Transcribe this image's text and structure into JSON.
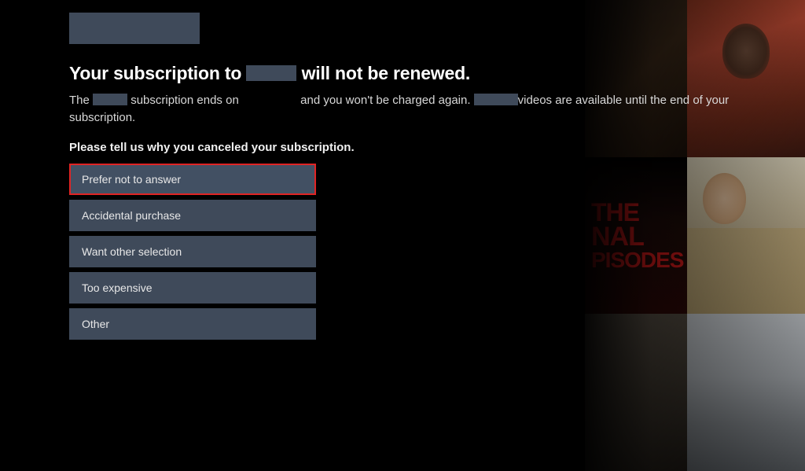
{
  "title": {
    "part1": "Your subscription to",
    "part2": "will not be renewed."
  },
  "body": {
    "part1": "The",
    "part2": "subscription ends on",
    "part3": "and you won't be charged again.",
    "part4": "videos are available until the end of your subscription."
  },
  "prompt": "Please tell us why you canceled your subscription.",
  "options": [
    {
      "label": "Prefer not to answer",
      "selected": true
    },
    {
      "label": "Accidental purchase",
      "selected": false
    },
    {
      "label": "Want other selection",
      "selected": false
    },
    {
      "label": "Too expensive",
      "selected": false
    },
    {
      "label": "Other",
      "selected": false
    }
  ],
  "bg_tile_text": {
    "l1": "THE",
    "l2": "NAL",
    "l3": "PISODES"
  }
}
